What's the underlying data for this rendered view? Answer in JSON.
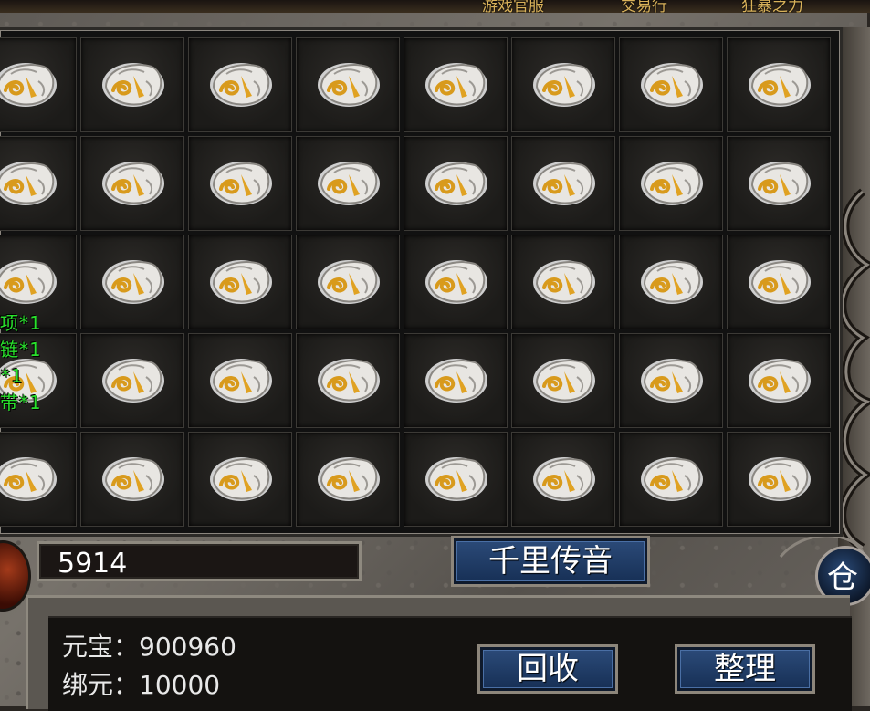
{
  "top_bar": {
    "items": [
      "游戏官服",
      "交易行",
      "狂暴之力"
    ]
  },
  "inventory": {
    "item_icon": "ore-stone-icon",
    "rows": 5,
    "cols": 8,
    "float_labels": [
      "项*1",
      "链*1",
      "*1",
      "带*1"
    ]
  },
  "controls": {
    "amount_value": "5914",
    "chuanyin_label": "千里传音",
    "recycle_label": "回收",
    "sort_label": "整理",
    "cang_label": "仓"
  },
  "currency": {
    "yuanbao_label": "元宝：",
    "yuanbao_value": "900960",
    "bangyuan_label": "绑元：",
    "bangyuan_value": "10000"
  },
  "colors": {
    "float_text": "#29e02c",
    "button_blue": "#173056",
    "panel_bg": "#141210"
  }
}
